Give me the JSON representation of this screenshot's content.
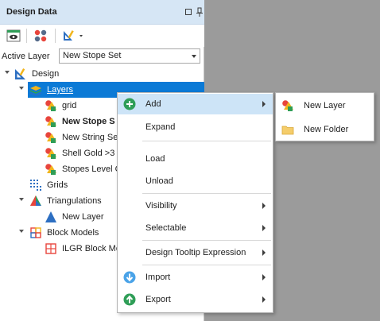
{
  "panel": {
    "title": "Design Data",
    "active_layer_label": "Active Layer",
    "active_layer_value": "New Stope Set"
  },
  "toolbar": {
    "buttons": [
      "eye-toolbar-icon",
      "shapes-toolbar-icon",
      "design-dropdown-toolbar-icon"
    ]
  },
  "tree": {
    "root": "Design",
    "layers": "Layers",
    "layer_items": [
      "grid",
      "New Stope S",
      "New String Se",
      "Shell Gold >3",
      "Stopes Level C"
    ],
    "grids": "Grids",
    "triangulations": "Triangulations",
    "tri_new_layer": "New Layer",
    "block_models": "Block Models",
    "ilgr": "ILGR Block Mo"
  },
  "context_menu": {
    "add": "Add",
    "expand": "Expand",
    "load": "Load",
    "unload": "Unload",
    "visibility": "Visibility",
    "selectable": "Selectable",
    "tooltip": "Design Tooltip Expression",
    "import": "Import",
    "export": "Export"
  },
  "submenu": {
    "new_layer": "New Layer",
    "new_folder": "New Folder"
  },
  "colors": {
    "title_bg": "#d6e6f5",
    "selection": "#0b7ad6",
    "menu_highlight": "#cde4f7",
    "desktop": "#9b9b9b"
  }
}
